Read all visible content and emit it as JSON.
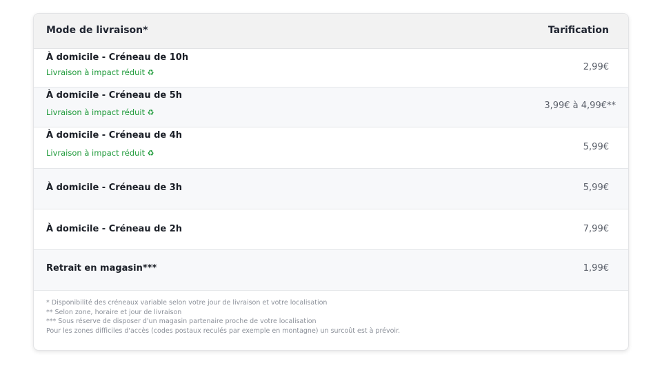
{
  "table": {
    "header": {
      "mode": "Mode de livraison*",
      "price": "Tarification"
    },
    "rows": [
      {
        "title": "À domicile - Créneau de 10h",
        "eco": "Livraison à impact réduit",
        "price": "2,99€"
      },
      {
        "title": "À domicile - Créneau de 5h",
        "eco": "Livraison à impact réduit",
        "price": "3,99€ à 4,99€**"
      },
      {
        "title": "À domicile - Créneau de 4h",
        "eco": "Livraison à impact réduit",
        "price": "5,99€"
      },
      {
        "title": "À domicile - Créneau de 3h",
        "price": "5,99€"
      },
      {
        "title": "À domicile - Créneau de 2h",
        "price": "7,99€"
      },
      {
        "title": "Retrait en magasin***",
        "price": "1,99€"
      }
    ],
    "eco_icon": "recycle-icon",
    "eco_symbol": "♻"
  },
  "footnotes": [
    "* Disponibilité des créneaux variable selon votre jour de livraison et votre localisation",
    "** Selon zone, horaire et jour de livraison",
    "*** Sous réserve de disposer d'un magasin partenaire proche de votre localisation",
    "Pour les zones difficiles d'accès (codes postaux reculés par exemple en montagne) un surcoût est à prévoir."
  ],
  "colors": {
    "eco_green": "#1e9a3a",
    "header_bg": "#f2f2f2",
    "alt_row_bg": "#f7f8fa"
  }
}
